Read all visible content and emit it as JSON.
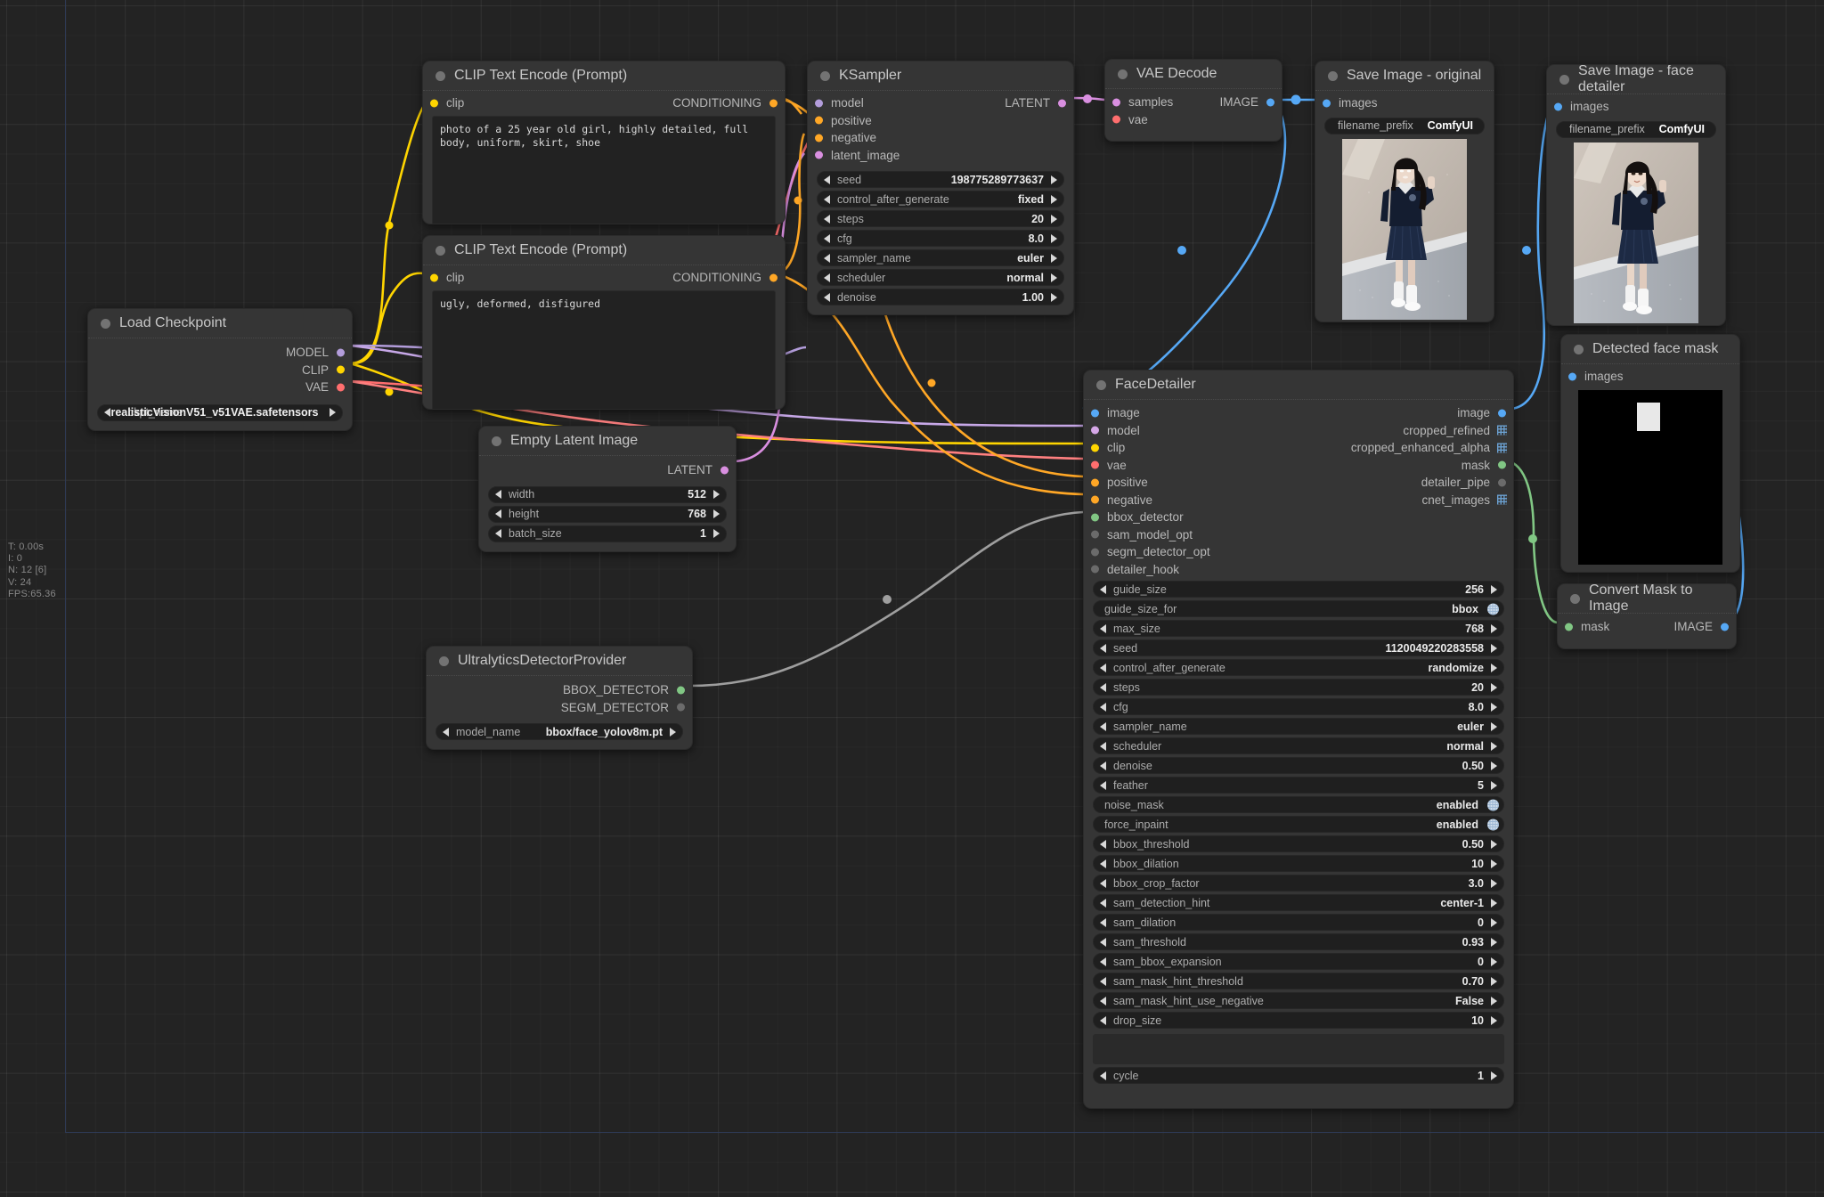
{
  "app": "ComfyUI",
  "stats_overlay": {
    "lines": [
      "T: 0.00s",
      "I: 0",
      "N: 12 [6]",
      "V: 24",
      "FPS:65.36"
    ],
    "text": "T: 0.00s\nI: 0\nN: 12 [6]\nV: 24\nFPS:65.36"
  },
  "colors": {
    "canvas": "#232323",
    "node_bg": "#353535",
    "widget_bg": "#1f1f1f",
    "link_clip": "#FFD500",
    "link_model": "#B39DDB",
    "link_vae": "#FF6E6E",
    "link_cond": "#FFA726",
    "link_latent": "#FF6AD5",
    "link_image": "#56A8F5",
    "link_mask": "#81C784",
    "link_bbox": "#9E9E9E"
  },
  "nodes": {
    "load_checkpoint": {
      "title": "Load Checkpoint",
      "outputs": [
        {
          "name": "MODEL",
          "color": "#B39DDB"
        },
        {
          "name": "CLIP",
          "color": "#FFD500"
        },
        {
          "name": "VAE",
          "color": "#FF6E6E"
        }
      ],
      "widgets": [
        {
          "label": "ckpt_name",
          "value": "realisticVisionV51_v51VAE.safetensors",
          "type": "combo-arrows"
        }
      ]
    },
    "clip_positive": {
      "title": "CLIP Text Encode (Prompt)",
      "inputs": [
        {
          "name": "clip",
          "color": "#FFD500"
        }
      ],
      "outputs": [
        {
          "name": "CONDITIONING",
          "color": "#FFA726"
        }
      ],
      "text": "photo of a 25 year old girl, highly detailed, full body, uniform, skirt, shoe"
    },
    "clip_negative": {
      "title": "CLIP Text Encode (Prompt)",
      "inputs": [
        {
          "name": "clip",
          "color": "#FFD500"
        }
      ],
      "outputs": [
        {
          "name": "CONDITIONING",
          "color": "#FFA726"
        }
      ],
      "text": "ugly, deformed, disfigured"
    },
    "empty_latent": {
      "title": "Empty Latent Image",
      "outputs": [
        {
          "name": "LATENT",
          "color": "#FF6AD5"
        }
      ],
      "widgets": [
        {
          "label": "width",
          "value": "512",
          "type": "combo-arrows"
        },
        {
          "label": "height",
          "value": "768",
          "type": "combo-arrows"
        },
        {
          "label": "batch_size",
          "value": "1",
          "type": "combo-arrows"
        }
      ]
    },
    "ksampler": {
      "title": "KSampler",
      "inputs": [
        {
          "name": "model",
          "color": "#B39DDB"
        },
        {
          "name": "positive",
          "color": "#FFA726"
        },
        {
          "name": "negative",
          "color": "#FFA726"
        },
        {
          "name": "latent_image",
          "color": "#FF6AD5"
        }
      ],
      "outputs": [
        {
          "name": "LATENT",
          "color": "#B39DDB"
        }
      ],
      "widgets": [
        {
          "label": "seed",
          "value": "198775289773637",
          "type": "combo-arrows"
        },
        {
          "label": "control_after_generate",
          "value": "fixed",
          "type": "combo-arrows"
        },
        {
          "label": "steps",
          "value": "20",
          "type": "combo-arrows"
        },
        {
          "label": "cfg",
          "value": "8.0",
          "type": "combo-arrows"
        },
        {
          "label": "sampler_name",
          "value": "euler",
          "type": "combo-arrows"
        },
        {
          "label": "scheduler",
          "value": "normal",
          "type": "combo-arrows"
        },
        {
          "label": "denoise",
          "value": "1.00",
          "type": "combo-arrows"
        }
      ]
    },
    "vae_decode": {
      "title": "VAE Decode",
      "inputs": [
        {
          "name": "samples",
          "color": "#B39DDB"
        },
        {
          "name": "vae",
          "color": "#FF6E6E"
        }
      ],
      "outputs": [
        {
          "name": "IMAGE",
          "color": "#56A8F5"
        }
      ]
    },
    "save_original": {
      "title": "Save Image - original",
      "inputs": [
        {
          "name": "images",
          "color": "#56A8F5"
        }
      ],
      "widgets": [
        {
          "label": "filename_prefix",
          "value": "ComfyUI",
          "type": "text"
        }
      ],
      "preview_alt": "generated photo of girl in navy uniform dress on sidewalk"
    },
    "save_face_detailer": {
      "title": "Save Image - face detailer",
      "inputs": [
        {
          "name": "images",
          "color": "#56A8F5"
        }
      ],
      "widgets": [
        {
          "label": "filename_prefix",
          "value": "ComfyUI",
          "type": "text"
        }
      ],
      "preview_alt": "face-detailed photo of girl in navy uniform dress"
    },
    "detected_face_mask": {
      "title": "Detected face mask",
      "inputs": [
        {
          "name": "images",
          "color": "#56A8F5"
        }
      ],
      "preview_alt": "black image with white rectangle face mask"
    },
    "convert_mask_to_image": {
      "title": "Convert Mask to Image",
      "inputs": [
        {
          "name": "mask",
          "color": "#81C784"
        }
      ],
      "outputs": [
        {
          "name": "IMAGE",
          "color": "#56A8F5"
        }
      ]
    },
    "ultralytics": {
      "title": "UltralyticsDetectorProvider",
      "outputs": [
        {
          "name": "BBOX_DETECTOR",
          "color": "#81C784"
        },
        {
          "name": "SEGM_DETECTOR",
          "color": "#9E9E9E"
        }
      ],
      "widgets": [
        {
          "label": "model_name",
          "value": "bbox/face_yolov8m.pt",
          "type": "combo-arrows"
        }
      ]
    },
    "face_detailer": {
      "title": "FaceDetailer",
      "inputs": [
        {
          "name": "image",
          "color": "#56A8F5"
        },
        {
          "name": "model",
          "color": "#D6A8E8"
        },
        {
          "name": "clip",
          "color": "#FFD500"
        },
        {
          "name": "vae",
          "color": "#FF6E6E"
        },
        {
          "name": "positive",
          "color": "#FFA726"
        },
        {
          "name": "negative",
          "color": "#FFA726"
        },
        {
          "name": "bbox_detector",
          "color": "#81C784"
        },
        {
          "name": "sam_model_opt",
          "color": "#8a8a8a"
        },
        {
          "name": "segm_detector_opt",
          "color": "#8a8a8a"
        },
        {
          "name": "detailer_hook",
          "color": "#8a8a8a"
        }
      ],
      "outputs": [
        {
          "name": "image",
          "color": "#56A8F5",
          "glyph": "dot"
        },
        {
          "name": "cropped_refined",
          "color": "#6fa8dc",
          "glyph": "grid"
        },
        {
          "name": "cropped_enhanced_alpha",
          "color": "#6fa8dc",
          "glyph": "grid"
        },
        {
          "name": "mask",
          "color": "#81C784",
          "glyph": "dot"
        },
        {
          "name": "detailer_pipe",
          "color": "#8a8a8a",
          "glyph": "dot"
        },
        {
          "name": "cnet_images",
          "color": "#6fa8dc",
          "glyph": "grid"
        }
      ],
      "widgets": [
        {
          "label": "guide_size",
          "value": "256",
          "type": "combo-arrows"
        },
        {
          "label": "guide_size_for",
          "value": "bbox",
          "type": "toggle"
        },
        {
          "label": "max_size",
          "value": "768",
          "type": "combo-arrows"
        },
        {
          "label": "seed",
          "value": "1120049220283558",
          "type": "combo-arrows"
        },
        {
          "label": "control_after_generate",
          "value": "randomize",
          "type": "combo-arrows"
        },
        {
          "label": "steps",
          "value": "20",
          "type": "combo-arrows"
        },
        {
          "label": "cfg",
          "value": "8.0",
          "type": "combo-arrows"
        },
        {
          "label": "sampler_name",
          "value": "euler",
          "type": "combo-arrows"
        },
        {
          "label": "scheduler",
          "value": "normal",
          "type": "combo-arrows"
        },
        {
          "label": "denoise",
          "value": "0.50",
          "type": "combo-arrows"
        },
        {
          "label": "feather",
          "value": "5",
          "type": "combo-arrows"
        },
        {
          "label": "noise_mask",
          "value": "enabled",
          "type": "toggle"
        },
        {
          "label": "force_inpaint",
          "value": "enabled",
          "type": "toggle"
        },
        {
          "label": "bbox_threshold",
          "value": "0.50",
          "type": "combo-arrows"
        },
        {
          "label": "bbox_dilation",
          "value": "10",
          "type": "combo-arrows"
        },
        {
          "label": "bbox_crop_factor",
          "value": "3.0",
          "type": "combo-arrows"
        },
        {
          "label": "sam_detection_hint",
          "value": "center-1",
          "type": "combo-arrows"
        },
        {
          "label": "sam_dilation",
          "value": "0",
          "type": "combo-arrows"
        },
        {
          "label": "sam_threshold",
          "value": "0.93",
          "type": "combo-arrows"
        },
        {
          "label": "sam_bbox_expansion",
          "value": "0",
          "type": "combo-arrows"
        },
        {
          "label": "sam_mask_hint_threshold",
          "value": "0.70",
          "type": "combo-arrows"
        },
        {
          "label": "sam_mask_hint_use_negative",
          "value": "False",
          "type": "combo-arrows"
        },
        {
          "label": "drop_size",
          "value": "10",
          "type": "combo-arrows"
        }
      ],
      "widgets_after_blank": [
        {
          "label": "cycle",
          "value": "1",
          "type": "combo-arrows"
        }
      ]
    }
  }
}
